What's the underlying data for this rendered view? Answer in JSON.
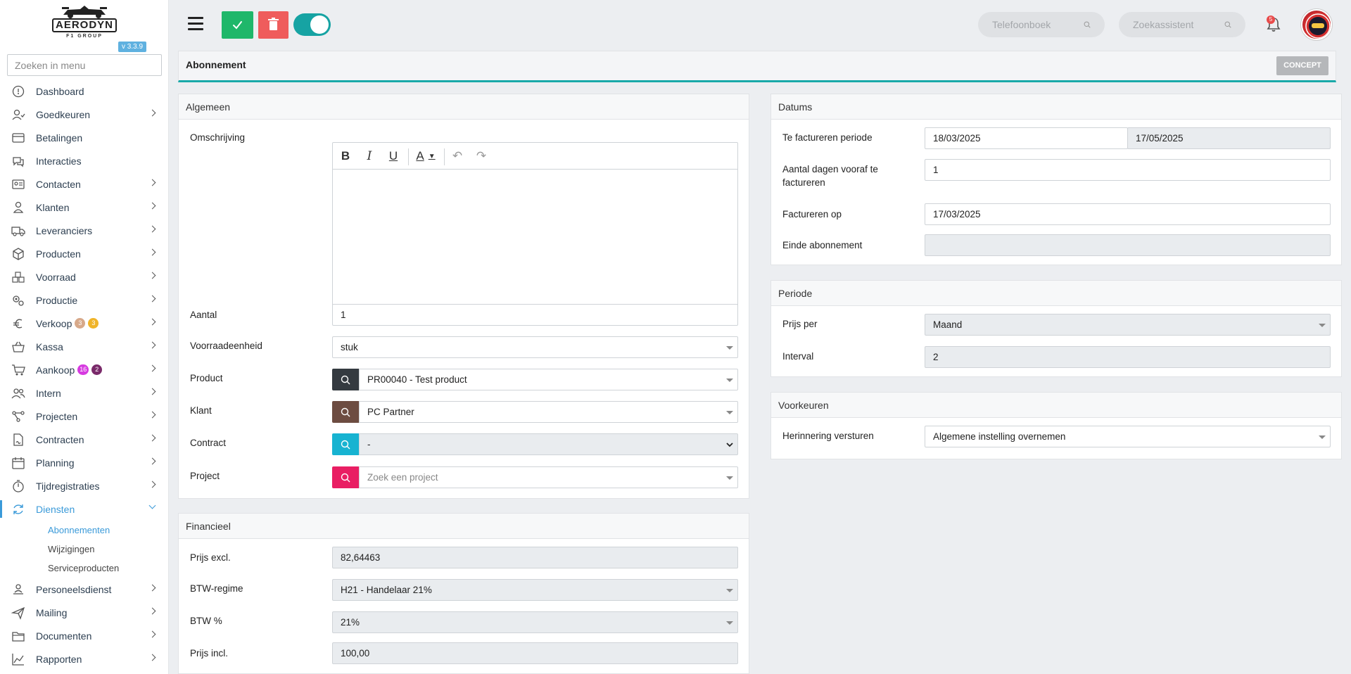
{
  "app": {
    "logo_text": "AERODYN",
    "logo_sub": "F1 GROUP",
    "version": "v 3.3.9"
  },
  "sidebar": {
    "search_placeholder": "Zoeken in menu",
    "items": [
      {
        "label": "Dashboard",
        "icon": "dashboard-icon",
        "chevron": false
      },
      {
        "label": "Goedkeuren",
        "icon": "user-check-icon",
        "chevron": true
      },
      {
        "label": "Betalingen",
        "icon": "credit-card-icon",
        "chevron": false
      },
      {
        "label": "Interacties",
        "icon": "chat-icon",
        "chevron": false
      },
      {
        "label": "Contacten",
        "icon": "contact-card-icon",
        "chevron": true
      },
      {
        "label": "Klanten",
        "icon": "customer-icon",
        "chevron": true
      },
      {
        "label": "Leveranciers",
        "icon": "truck-icon",
        "chevron": true
      },
      {
        "label": "Producten",
        "icon": "box-icon",
        "chevron": true
      },
      {
        "label": "Voorraad",
        "icon": "boxes-icon",
        "chevron": true
      },
      {
        "label": "Productie",
        "icon": "gears-icon",
        "chevron": true
      },
      {
        "label": "Verkoop",
        "icon": "euro-icon",
        "chevron": true,
        "badges": [
          {
            "text": "3",
            "color": "#d7a98a"
          },
          {
            "text": "3",
            "color": "#f0b429"
          }
        ]
      },
      {
        "label": "Kassa",
        "icon": "basket-icon",
        "chevron": true
      },
      {
        "label": "Aankoop",
        "icon": "cart-icon",
        "chevron": true,
        "badges": [
          {
            "text": "16",
            "color": "#d63ae0"
          },
          {
            "text": "2",
            "color": "#7a2a6a"
          }
        ]
      },
      {
        "label": "Intern",
        "icon": "users-icon",
        "chevron": true
      },
      {
        "label": "Projecten",
        "icon": "project-nodes-icon",
        "chevron": true
      },
      {
        "label": "Contracten",
        "icon": "contract-icon",
        "chevron": true
      },
      {
        "label": "Planning",
        "icon": "calendar-icon",
        "chevron": true
      },
      {
        "label": "Tijdregistraties",
        "icon": "timer-icon",
        "chevron": true
      },
      {
        "label": "Diensten",
        "icon": "refresh-icon",
        "chevron": true,
        "active": true
      }
    ],
    "sub_items": [
      {
        "label": "Abonnementen",
        "active": true
      },
      {
        "label": "Wijzigingen"
      },
      {
        "label": "Serviceproducten"
      }
    ],
    "items_after": [
      {
        "label": "Personeelsdienst",
        "icon": "person-desk-icon",
        "chevron": true
      },
      {
        "label": "Mailing",
        "icon": "send-icon",
        "chevron": true
      },
      {
        "label": "Documenten",
        "icon": "folder-icon",
        "chevron": true
      },
      {
        "label": "Rapporten",
        "icon": "chart-line-icon",
        "chevron": true
      }
    ]
  },
  "topbar": {
    "phonebook_placeholder": "Telefoonboek",
    "assistant_placeholder": "Zoekassistent",
    "notification_count": "5"
  },
  "page": {
    "title": "Abonnement",
    "status": "CONCEPT"
  },
  "algemeen": {
    "heading": "Algemeen",
    "omschrijving_label": "Omschrijving",
    "aantal_label": "Aantal",
    "aantal_value": "1",
    "voorraadeenheid_label": "Voorraadeenheid",
    "voorraadeenheid_value": "stuk",
    "product_label": "Product",
    "product_value": "PR00040 - Test product",
    "klant_label": "Klant",
    "klant_value": "PC Partner",
    "contract_label": "Contract",
    "contract_value": "-",
    "project_label": "Project",
    "project_placeholder": "Zoek een project"
  },
  "financieel": {
    "heading": "Financieel",
    "prijs_excl_label": "Prijs excl.",
    "prijs_excl_value": "82,64463",
    "btw_regime_label": "BTW-regime",
    "btw_regime_value": "H21 - Handelaar 21%",
    "btw_pct_label": "BTW %",
    "btw_pct_value": "21%",
    "prijs_incl_label": "Prijs incl.",
    "prijs_incl_value": "100,00"
  },
  "datums": {
    "heading": "Datums",
    "periode_label": "Te factureren periode",
    "periode_from": "18/03/2025",
    "periode_to": "17/05/2025",
    "dagen_label_1": "Aantal dagen vooraf te",
    "dagen_label_2": "factureren",
    "dagen_value": "1",
    "factureren_op_label": "Factureren op",
    "factureren_op_value": "17/03/2025",
    "einde_label": "Einde abonnement",
    "einde_value": ""
  },
  "periode": {
    "heading": "Periode",
    "prijs_per_label": "Prijs per",
    "prijs_per_value": "Maand",
    "interval_label": "Interval",
    "interval_value": "2"
  },
  "voorkeuren": {
    "heading": "Voorkeuren",
    "herinnering_label": "Herinnering versturen",
    "herinnering_value": "Algemene instelling overnemen"
  },
  "colors": {
    "accent": "#19a9a9",
    "active_blue": "#3a9ad9",
    "save_green": "#1fb76a",
    "delete_red": "#ef5c5c",
    "product_addon": "#343a40",
    "klant_addon": "#6d4c41",
    "contract_addon": "#17b3d1",
    "project_addon": "#e91e63"
  }
}
